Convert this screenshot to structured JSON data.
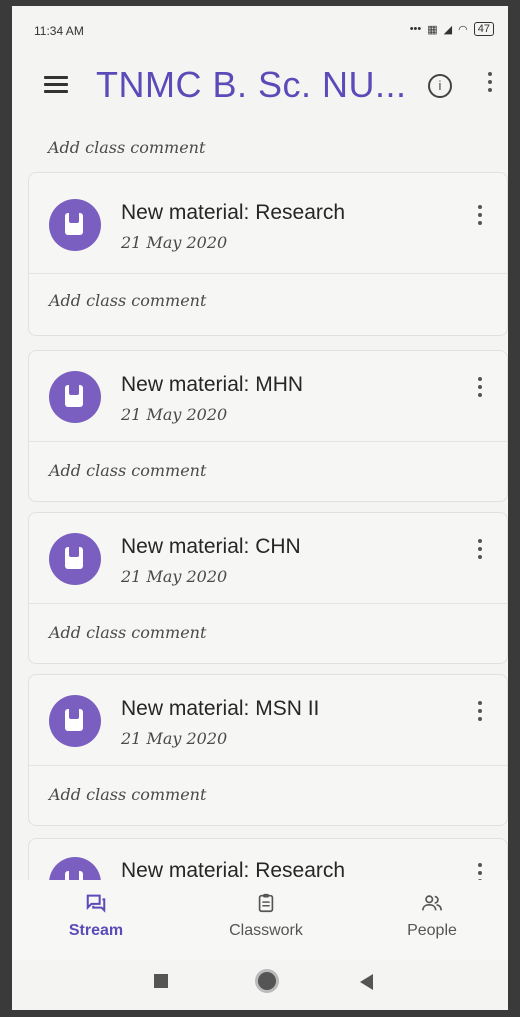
{
  "status_bar": {
    "time": "11:34 AM",
    "battery": "47"
  },
  "app_bar": {
    "title": "TNMC B. Sc. NU..."
  },
  "feed": {
    "top_comment": "Add class comment",
    "posts": [
      {
        "title": "New material: Research",
        "date": "21 May 2020",
        "comment": "Add class comment"
      },
      {
        "title": "New material: MHN",
        "date": "21 May 2020",
        "comment": "Add class comment"
      },
      {
        "title": "New material: CHN",
        "date": "21 May 2020",
        "comment": "Add class comment"
      },
      {
        "title": "New material: MSN II",
        "date": "21 May 2020",
        "comment": "Add class comment"
      },
      {
        "title": "New material: Research",
        "date": "",
        "comment": ""
      }
    ]
  },
  "bottom_nav": {
    "items": [
      {
        "label": "Stream",
        "icon": "stream-icon",
        "active": true
      },
      {
        "label": "Classwork",
        "icon": "classwork-icon",
        "active": false
      },
      {
        "label": "People",
        "icon": "people-icon",
        "active": false
      }
    ]
  },
  "colors": {
    "accent": "#5b4bb8",
    "avatar": "#7b5fc0"
  }
}
